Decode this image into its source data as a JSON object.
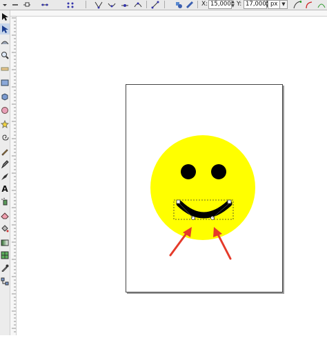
{
  "toolbar": {
    "x_label": "X:",
    "x_value": "15,000",
    "y_label": "Y:",
    "y_value": "17,000",
    "unit": "px"
  },
  "tools": [
    {
      "name": "selector-tool-icon"
    },
    {
      "name": "node-tool-icon"
    },
    {
      "name": "tweak-tool-icon"
    },
    {
      "name": "zoom-tool-icon"
    },
    {
      "name": "measure-tool-icon"
    },
    {
      "name": "rectangle-tool-icon"
    },
    {
      "name": "3d-box-tool-icon"
    },
    {
      "name": "ellipse-tool-icon"
    },
    {
      "name": "star-tool-icon"
    },
    {
      "name": "spiral-tool-icon"
    },
    {
      "name": "pencil-tool-icon"
    },
    {
      "name": "pen-tool-icon"
    },
    {
      "name": "calligraphy-tool-icon"
    },
    {
      "name": "text-tool-icon"
    },
    {
      "name": "spray-tool-icon"
    },
    {
      "name": "eraser-tool-icon"
    },
    {
      "name": "paint-bucket-tool-icon"
    },
    {
      "name": "gradient-tool-icon"
    },
    {
      "name": "mesh-tool-icon"
    },
    {
      "name": "dropper-tool-icon"
    },
    {
      "name": "connector-tool-icon"
    }
  ],
  "text_tool_glyph": "A",
  "colors": {
    "face": "#ffff00",
    "features": "#000000",
    "arrow": "#e53a2a",
    "page_border": "#444444"
  }
}
